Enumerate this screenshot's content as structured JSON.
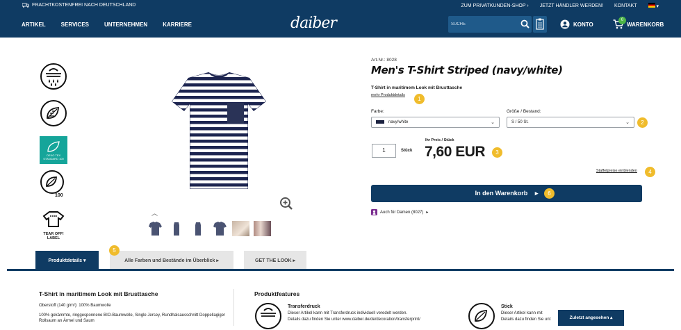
{
  "topbar": {
    "shipping": "FRACHTKOSTENFREI NACH DEUTSCHLAND",
    "private_shop": "ZUM PRIVATKUNDEN-SHOP",
    "dealer": "JETZT HÄNDLER WERDEN!",
    "contact": "KONTAKT"
  },
  "nav": {
    "items": [
      "ARTIKEL",
      "SERVICES",
      "UNTERNEHMEN",
      "KARRIERE"
    ],
    "logo": "daiber",
    "search_placeholder": "SUCHE",
    "account": "KONTO",
    "cart": "WARENKORB",
    "cart_count": "0"
  },
  "feature_icons": {
    "oeko_text": "OEKO TEX STANDARD 100",
    "tearoff": "TEAR OFF! LABEL",
    "badge_100": "100"
  },
  "product": {
    "art_nr": "Art-Nr.: 8028",
    "title": "Men's T-Shirt Striped (navy/white)",
    "subtitle": "T-Shirt in maritimem Look mit Brusttasche",
    "more_details": "mehr Produktdetails",
    "color_label": "Farbe:",
    "color_value": "navy/white",
    "size_label": "Größe / Bestand:",
    "size_value": "S / 50 St.",
    "qty_value": "1",
    "qty_unit": "Stück",
    "price_label": "Ihr Preis / Stück",
    "price": "7,60 EUR",
    "tier_link": "Staffelpreise einblenden",
    "cart_button": "In den Warenkorb",
    "womens_link": "Auch für Damen (8027)"
  },
  "steps": [
    "1",
    "2",
    "3",
    "4",
    "5",
    "6"
  ],
  "tabs": [
    "Produktdetails",
    "Alle Farben und Bestände im Überblick",
    "GET THE LOOK"
  ],
  "details": {
    "heading": "T-Shirt in maritimem Look mit Brusttasche",
    "fabric": "Oberstoff (140 g/m²): 100% Baumwolle",
    "desc": "100% gekämmte, ringgesponnene BIO-Baumwolle, Single Jersey, Rundhalsausschnitt Doppellagiger Rollsaum an Ärmel und Saum"
  },
  "features": {
    "heading": "Produktfeatures",
    "items": [
      {
        "title": "Transferdruck",
        "desc1": "Dieser Artikel kann mit Transferdruck individuell veredelt werden.",
        "desc2": "Details dazu finden Sie unter www.daiber.de/de/decoration/transferprint/"
      },
      {
        "title": "Stick",
        "desc1": "Dieser Artikel kann mit",
        "desc2": "Details dazu finden Sie unt"
      }
    ]
  },
  "recently_viewed": "Zuletzt angesehen",
  "colors": {
    "navy": "#0f3b63",
    "accent": "#f0bc2c",
    "green": "#4db546"
  }
}
